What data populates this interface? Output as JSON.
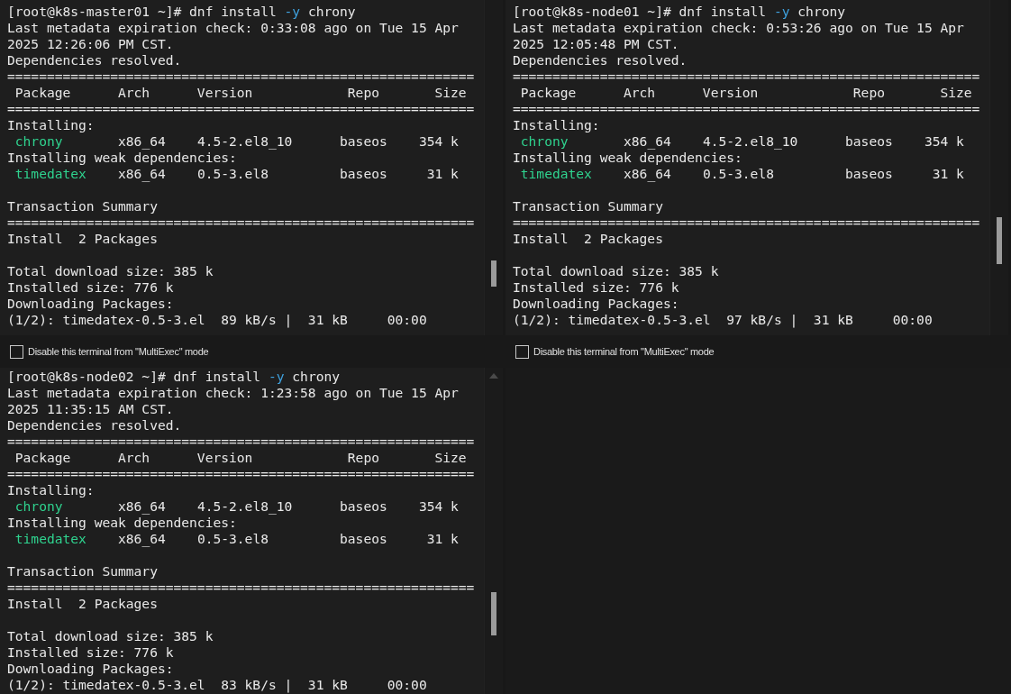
{
  "terminals": [
    {
      "lines": [
        {
          "kind": "text",
          "segments": [
            {
              "text": "[root@k8s-master01 ~]# dnf install ",
              "kind": "plain"
            },
            {
              "text": "-y",
              "kind": "option"
            },
            {
              "text": " chrony",
              "kind": "plain"
            }
          ]
        },
        {
          "kind": "text",
          "segments": [
            {
              "text": "Last metadata expiration check: 0:33:08 ago on Tue 15 Apr",
              "kind": "plain"
            }
          ]
        },
        {
          "kind": "text",
          "segments": [
            {
              "text": "2025 12:26:06 PM CST.",
              "kind": "plain"
            }
          ]
        },
        {
          "kind": "text",
          "segments": [
            {
              "text": "Dependencies resolved.",
              "kind": "plain"
            }
          ]
        },
        {
          "kind": "text",
          "segments": [
            {
              "text": "===========================================================",
              "kind": "plain"
            }
          ]
        },
        {
          "kind": "text",
          "segments": [
            {
              "text": " Package      Arch      Version            Repo       Size",
              "kind": "plain"
            }
          ]
        },
        {
          "kind": "text",
          "segments": [
            {
              "text": "===========================================================",
              "kind": "plain"
            }
          ]
        },
        {
          "kind": "text",
          "segments": [
            {
              "text": "Installing:",
              "kind": "plain"
            }
          ]
        },
        {
          "kind": "text",
          "segments": [
            {
              "text": " chrony",
              "kind": "package"
            },
            {
              "text": "       x86_64    4.5-2.el8_10      baseos    354 k",
              "kind": "plain"
            }
          ]
        },
        {
          "kind": "text",
          "segments": [
            {
              "text": "Installing weak dependencies:",
              "kind": "plain"
            }
          ]
        },
        {
          "kind": "text",
          "segments": [
            {
              "text": " timedatex",
              "kind": "package"
            },
            {
              "text": "    x86_64    0.5-3.el8         baseos     31 k",
              "kind": "plain"
            }
          ]
        },
        {
          "kind": "blank"
        },
        {
          "kind": "text",
          "segments": [
            {
              "text": "Transaction Summary",
              "kind": "plain"
            }
          ]
        },
        {
          "kind": "text",
          "segments": [
            {
              "text": "===========================================================",
              "kind": "plain"
            }
          ]
        },
        {
          "kind": "text",
          "segments": [
            {
              "text": "Install  2 Packages",
              "kind": "plain"
            }
          ]
        },
        {
          "kind": "blank"
        },
        {
          "kind": "text",
          "segments": [
            {
              "text": "Total download size: 385 k",
              "kind": "plain"
            }
          ]
        },
        {
          "kind": "text",
          "segments": [
            {
              "text": "Installed size: 776 k",
              "kind": "plain"
            }
          ]
        },
        {
          "kind": "text",
          "segments": [
            {
              "text": "Downloading Packages:",
              "kind": "plain"
            }
          ]
        },
        {
          "kind": "text",
          "segments": [
            {
              "text": "(1/2): timedatex-0.5-3.el  89 kB/s |  31 kB     00:00",
              "kind": "plain"
            }
          ]
        }
      ],
      "multiexec_option": {
        "label": "Disable this terminal from \"MultiExec\" mode",
        "checked": false
      }
    },
    {
      "lines": [
        {
          "kind": "text",
          "segments": [
            {
              "text": "[root@k8s-node01 ~]# dnf install ",
              "kind": "plain"
            },
            {
              "text": "-y",
              "kind": "option"
            },
            {
              "text": " chrony",
              "kind": "plain"
            }
          ]
        },
        {
          "kind": "text",
          "segments": [
            {
              "text": "Last metadata expiration check: 0:53:26 ago on Tue 15 Apr",
              "kind": "plain"
            }
          ]
        },
        {
          "kind": "text",
          "segments": [
            {
              "text": "2025 12:05:48 PM CST.",
              "kind": "plain"
            }
          ]
        },
        {
          "kind": "text",
          "segments": [
            {
              "text": "Dependencies resolved.",
              "kind": "plain"
            }
          ]
        },
        {
          "kind": "text",
          "segments": [
            {
              "text": "===========================================================",
              "kind": "plain"
            }
          ]
        },
        {
          "kind": "text",
          "segments": [
            {
              "text": " Package      Arch      Version            Repo       Size",
              "kind": "plain"
            }
          ]
        },
        {
          "kind": "text",
          "segments": [
            {
              "text": "===========================================================",
              "kind": "plain"
            }
          ]
        },
        {
          "kind": "text",
          "segments": [
            {
              "text": "Installing:",
              "kind": "plain"
            }
          ]
        },
        {
          "kind": "text",
          "segments": [
            {
              "text": " chrony",
              "kind": "package"
            },
            {
              "text": "       x86_64    4.5-2.el8_10      baseos    354 k",
              "kind": "plain"
            }
          ]
        },
        {
          "kind": "text",
          "segments": [
            {
              "text": "Installing weak dependencies:",
              "kind": "plain"
            }
          ]
        },
        {
          "kind": "text",
          "segments": [
            {
              "text": " timedatex",
              "kind": "package"
            },
            {
              "text": "    x86_64    0.5-3.el8         baseos     31 k",
              "kind": "plain"
            }
          ]
        },
        {
          "kind": "blank"
        },
        {
          "kind": "text",
          "segments": [
            {
              "text": "Transaction Summary",
              "kind": "plain"
            }
          ]
        },
        {
          "kind": "text",
          "segments": [
            {
              "text": "===========================================================",
              "kind": "plain"
            }
          ]
        },
        {
          "kind": "text",
          "segments": [
            {
              "text": "Install  2 Packages",
              "kind": "plain"
            }
          ]
        },
        {
          "kind": "blank"
        },
        {
          "kind": "text",
          "segments": [
            {
              "text": "Total download size: 385 k",
              "kind": "plain"
            }
          ]
        },
        {
          "kind": "text",
          "segments": [
            {
              "text": "Installed size: 776 k",
              "kind": "plain"
            }
          ]
        },
        {
          "kind": "text",
          "segments": [
            {
              "text": "Downloading Packages:",
              "kind": "plain"
            }
          ]
        },
        {
          "kind": "text",
          "segments": [
            {
              "text": "(1/2): timedatex-0.5-3.el  97 kB/s |  31 kB     00:00",
              "kind": "plain"
            }
          ]
        }
      ],
      "multiexec_option": {
        "label": "Disable this terminal from \"MultiExec\" mode",
        "checked": false
      }
    },
    {
      "lines": [
        {
          "kind": "text",
          "segments": [
            {
              "text": "[root@k8s-node02 ~]# dnf install ",
              "kind": "plain"
            },
            {
              "text": "-y",
              "kind": "option"
            },
            {
              "text": " chrony",
              "kind": "plain"
            }
          ]
        },
        {
          "kind": "text",
          "segments": [
            {
              "text": "Last metadata expiration check: 1:23:58 ago on Tue 15 Apr",
              "kind": "plain"
            }
          ]
        },
        {
          "kind": "text",
          "segments": [
            {
              "text": "2025 11:35:15 AM CST.",
              "kind": "plain"
            }
          ]
        },
        {
          "kind": "text",
          "segments": [
            {
              "text": "Dependencies resolved.",
              "kind": "plain"
            }
          ]
        },
        {
          "kind": "text",
          "segments": [
            {
              "text": "===========================================================",
              "kind": "plain"
            }
          ]
        },
        {
          "kind": "text",
          "segments": [
            {
              "text": " Package      Arch      Version            Repo       Size",
              "kind": "plain"
            }
          ]
        },
        {
          "kind": "text",
          "segments": [
            {
              "text": "===========================================================",
              "kind": "plain"
            }
          ]
        },
        {
          "kind": "text",
          "segments": [
            {
              "text": "Installing:",
              "kind": "plain"
            }
          ]
        },
        {
          "kind": "text",
          "segments": [
            {
              "text": " chrony",
              "kind": "package"
            },
            {
              "text": "       x86_64    4.5-2.el8_10      baseos    354 k",
              "kind": "plain"
            }
          ]
        },
        {
          "kind": "text",
          "segments": [
            {
              "text": "Installing weak dependencies:",
              "kind": "plain"
            }
          ]
        },
        {
          "kind": "text",
          "segments": [
            {
              "text": " timedatex",
              "kind": "package"
            },
            {
              "text": "    x86_64    0.5-3.el8         baseos     31 k",
              "kind": "plain"
            }
          ]
        },
        {
          "kind": "blank"
        },
        {
          "kind": "text",
          "segments": [
            {
              "text": "Transaction Summary",
              "kind": "plain"
            }
          ]
        },
        {
          "kind": "text",
          "segments": [
            {
              "text": "===========================================================",
              "kind": "plain"
            }
          ]
        },
        {
          "kind": "text",
          "segments": [
            {
              "text": "Install  2 Packages",
              "kind": "plain"
            }
          ]
        },
        {
          "kind": "blank"
        },
        {
          "kind": "text",
          "segments": [
            {
              "text": "Total download size: 385 k",
              "kind": "plain"
            }
          ]
        },
        {
          "kind": "text",
          "segments": [
            {
              "text": "Installed size: 776 k",
              "kind": "plain"
            }
          ]
        },
        {
          "kind": "text",
          "segments": [
            {
              "text": "Downloading Packages:",
              "kind": "plain"
            }
          ]
        },
        {
          "kind": "text",
          "segments": [
            {
              "text": "(1/2): timedatex-0.5-3.el  83 kB/s |  31 kB     00:00",
              "kind": "plain"
            }
          ]
        }
      ]
    }
  ]
}
